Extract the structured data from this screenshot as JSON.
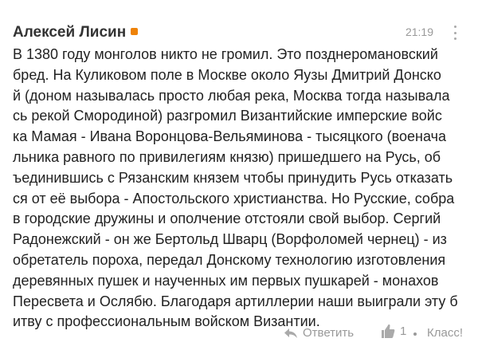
{
  "comment": {
    "author": "Алексей Лисин",
    "time": "21:19",
    "text_lines": [
      "В 1380 году монголов никто не громил. Это позднеромановский",
      "бред. На Куликовом поле в Москве около Яузы Дмитрий Донско",
      "й (доном называлась просто любая река, Москва тогда называла",
      "сь рекой Смородиной) разгромил Византийские имперские войс",
      "ка Мамая - Ивана Воронцова-Вельяминова - тысяцкого (военача",
      "льника равного по привилегиям князю) пришедшего на Русь, об",
      "ъединившись с Рязанским князем чтобы принудить Русь отказать",
      "ся от её выбора - Апостольского христианства. Но Русские, собра",
      "в городские дружины и ополчение отстояли свой выбор. Сергий",
      "Радонежский - он же Бертольд Шварц (Ворфоломей чернец) - из",
      "обретатель пороха, передал Донскому технологию изготовления",
      "деревянных пушек и наученных им первых пушкарей - монахов",
      "Пересвета и Ослябю. Благодаря артиллерии наши выиграли эту б",
      "итву с профессиональным войском Византии."
    ],
    "actions": {
      "reply_label": "Ответить",
      "like_count": "1",
      "klass_label": "Класс!"
    },
    "colors": {
      "online_badge": "#ee8208",
      "muted_text": "#999999"
    },
    "icons": [
      "reply-icon",
      "thumbs-up-icon",
      "more-vertical-icon"
    ]
  }
}
